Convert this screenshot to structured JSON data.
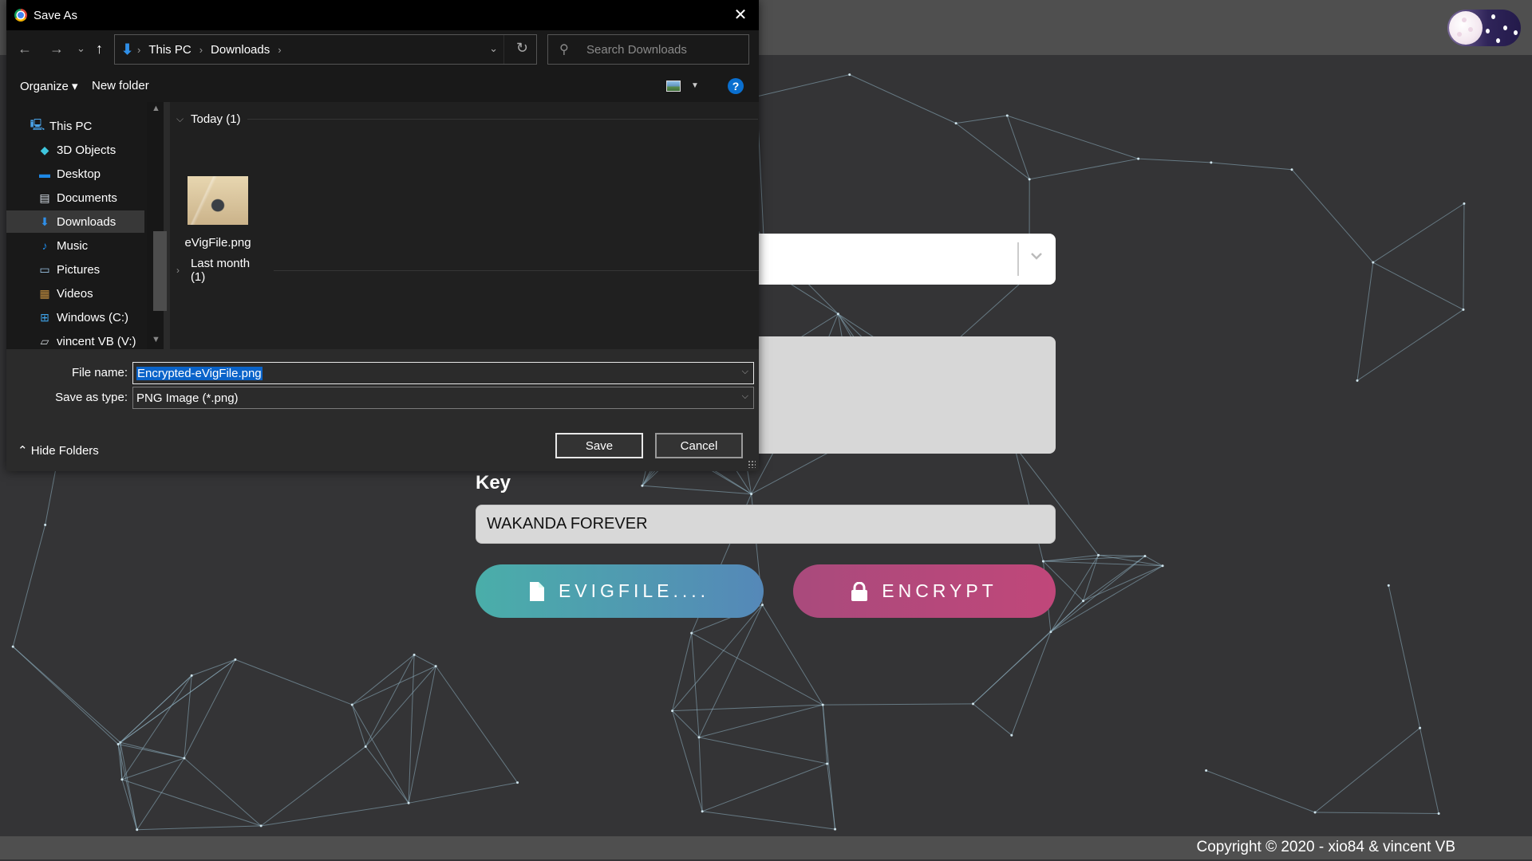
{
  "app": {
    "theme_toggle_icon": "moon-night-icon",
    "mode_select": {
      "value": "",
      "chevron_icon": "chevron-down-icon"
    },
    "message_text": "",
    "key": {
      "label": "Key",
      "value": "WAKANDA FOREVER"
    },
    "file_button": {
      "label": "EVIGFILE....",
      "icon": "file-icon"
    },
    "encrypt_button": {
      "label": "ENCRYPT",
      "icon": "lock-icon"
    },
    "footer": "Copyright © 2020 - xio84 & vincent VB",
    "colors": {
      "header_bg": "#4f4f4f",
      "page_bg": "#343436",
      "file_button_gradient": [
        "#4aaea9",
        "#5588b8"
      ],
      "encrypt_button_gradient": [
        "#a94a7c",
        "#c0477a"
      ],
      "network_line": "#8fb3c2"
    }
  },
  "dialog": {
    "title": "Save As",
    "close_label": "✕",
    "nav": {
      "back": "←",
      "forward": "→",
      "recent": "⌄",
      "up": "↑",
      "breadcrumb": [
        "This PC",
        "Downloads"
      ],
      "search_placeholder": "Search Downloads"
    },
    "commands": {
      "organize": "Organize ▾",
      "new_folder": "New folder",
      "help": "?"
    },
    "tree": [
      {
        "label": "This PC",
        "icon": "computer-icon",
        "selected": false,
        "indent": 0
      },
      {
        "label": "3D Objects",
        "icon": "cube-3d-icon",
        "selected": false,
        "indent": 1
      },
      {
        "label": "Desktop",
        "icon": "desktop-icon",
        "selected": false,
        "indent": 1
      },
      {
        "label": "Documents",
        "icon": "document-icon",
        "selected": false,
        "indent": 1
      },
      {
        "label": "Downloads",
        "icon": "download-icon",
        "selected": true,
        "indent": 1
      },
      {
        "label": "Music",
        "icon": "music-note-icon",
        "selected": false,
        "indent": 1
      },
      {
        "label": "Pictures",
        "icon": "pictures-icon",
        "selected": false,
        "indent": 1
      },
      {
        "label": "Videos",
        "icon": "film-icon",
        "selected": false,
        "indent": 1
      },
      {
        "label": "Windows (C:)",
        "icon": "windows-drive-icon",
        "selected": false,
        "indent": 1
      },
      {
        "label": "vincent VB (V:)",
        "icon": "drive-icon",
        "selected": false,
        "indent": 1
      }
    ],
    "groups": [
      {
        "label": "Today (1)",
        "expanded": true
      },
      {
        "label": "Last month (1)",
        "expanded": false
      }
    ],
    "files": [
      {
        "name": "eVigFile.png"
      }
    ],
    "file_name": {
      "label": "File name:",
      "value": "Encrypted-eVigFile.png"
    },
    "save_type": {
      "label": "Save as type:",
      "value": "PNG Image (*.png)"
    },
    "hide_folders": "Hide Folders",
    "save_label": "Save",
    "cancel_label": "Cancel"
  }
}
